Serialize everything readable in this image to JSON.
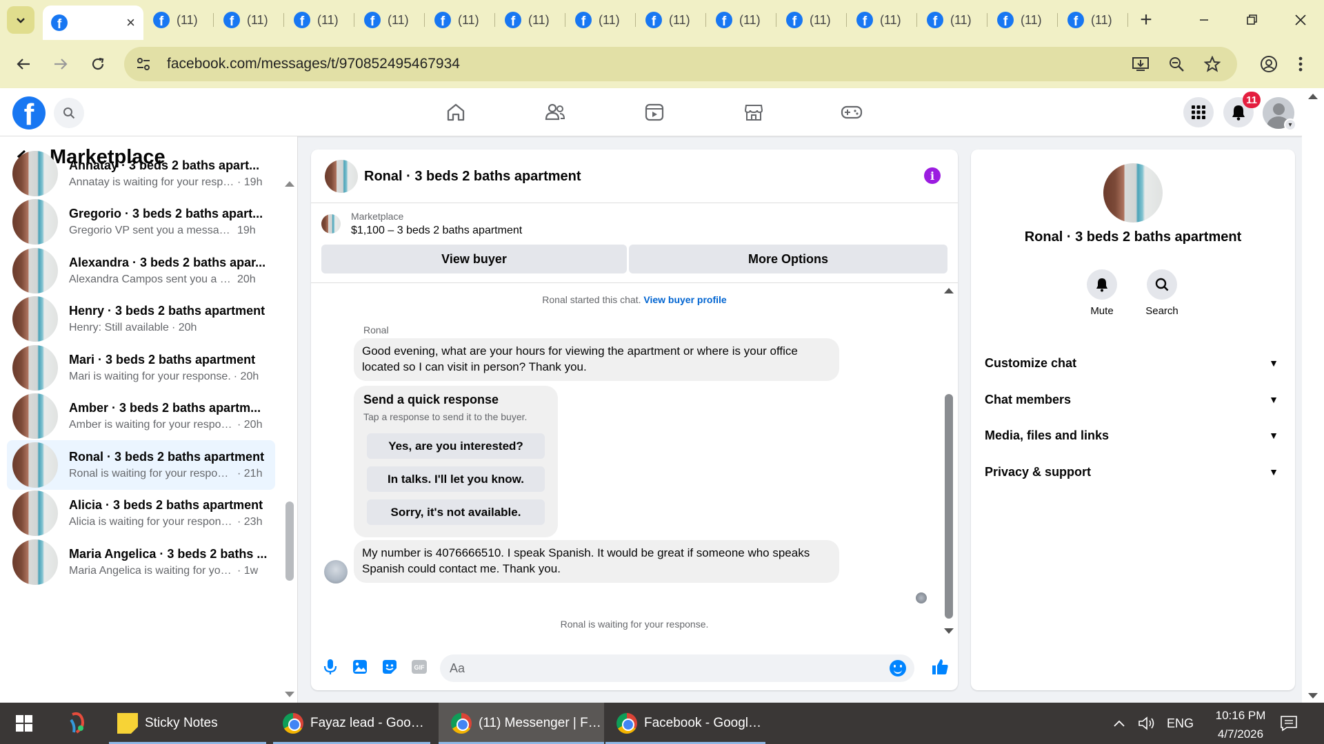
{
  "browser": {
    "active_tab": {
      "close": "×"
    },
    "inactive_tabs": [
      {
        "count": "(11)"
      },
      {
        "count": "(11)"
      },
      {
        "count": "(11)"
      },
      {
        "count": "(11)"
      },
      {
        "count": "(11)"
      },
      {
        "count": "(11)"
      },
      {
        "count": "(11)"
      },
      {
        "count": "(11)"
      },
      {
        "count": "(11)"
      },
      {
        "count": "(11)"
      },
      {
        "count": "(11)"
      },
      {
        "count": "(11)"
      },
      {
        "count": "(11)"
      },
      {
        "count": "(11)"
      }
    ],
    "new_tab": "+",
    "url": "facebook.com/messages/t/970852495467934",
    "accent_color": "#f1f0c6"
  },
  "fb_header": {
    "logo_letter": "f",
    "notification_count": "11",
    "brand_color": "#1877f2"
  },
  "sidebar": {
    "title": "Marketplace",
    "conversations": [
      {
        "title": "Annatay · 3 beds 2 baths apart...",
        "snippet": "Annatay is waiting for your respo...",
        "time": "· 19h"
      },
      {
        "title": "Gregorio · 3 beds 2 baths apart...",
        "snippet": "Gregorio VP sent you a message ...",
        "time": "19h"
      },
      {
        "title": "Alexandra · 3 beds 2 baths apar...",
        "snippet": "Alexandra Campos sent you a me...",
        "time": "20h"
      },
      {
        "title": "Henry · 3 beds 2 baths apartment",
        "snippet": "Henry: Still available",
        "time": "· 20h"
      },
      {
        "title": "Mari · 3 beds 2 baths apartment",
        "snippet": "Mari is waiting for your response.",
        "time": "· 20h"
      },
      {
        "title": "Amber · 3 beds 2 baths apartm...",
        "snippet": "Amber is waiting for your respon...",
        "time": "· 20h"
      },
      {
        "title": "Ronal · 3 beds 2 baths apartment",
        "snippet": "Ronal is waiting for your response.",
        "time": "· 21h"
      },
      {
        "title": "Alicia · 3 beds 2 baths apartment",
        "snippet": "Alicia is waiting for your response.",
        "time": "· 23h"
      },
      {
        "title": "Maria Angelica · 3 beds 2 baths ...",
        "snippet": "Maria Angelica is waiting for your ...",
        "time": "· 1w"
      }
    ]
  },
  "chat": {
    "title": "Ronal · 3 beds 2 baths apartment",
    "info_glyph": "i",
    "listing": {
      "source": "Marketplace",
      "title": "$1,100 – 3 beds 2 baths apartment",
      "view_buyer": "View buyer",
      "more_options": "More Options"
    },
    "system_note": "Ronal started this chat.",
    "system_link": "View buyer profile",
    "sender_name": "Ronal",
    "message_1": "Good evening, what are your hours for viewing the apartment or where is your office located so I can visit in person? Thank you.",
    "quick_response": {
      "title": "Send a quick response",
      "subtitle": "Tap a response to send it to the buyer.",
      "options": [
        "Yes, are you interested?",
        "In talks. I'll let you know.",
        "Sorry, it's not available."
      ]
    },
    "message_2": "My number is 4076666510. I speak Spanish. It would be great if someone who speaks Spanish could contact me. Thank you.",
    "waiting_note": "Ronal is waiting for your response.",
    "composer_placeholder": "Aa",
    "accent_color": "#0084ff"
  },
  "info_panel": {
    "title": "Ronal · 3 beds 2 baths apartment",
    "actions": [
      "Mute",
      "Search"
    ],
    "sections": [
      "Customize chat",
      "Chat members",
      "Media, files and links",
      "Privacy & support"
    ]
  },
  "taskbar": {
    "apps": [
      {
        "label": "Sticky Notes",
        "icon": "sticky-notes-icon"
      },
      {
        "label": "Fayaz lead - Google...",
        "icon": "chrome-icon"
      },
      {
        "label": "(11) Messenger | Fa...",
        "icon": "chrome-icon"
      },
      {
        "label": "Facebook - Google ...",
        "icon": "chrome-icon"
      }
    ],
    "language": "ENG",
    "time": "10:16 PM",
    "date": "4/7/2026"
  }
}
